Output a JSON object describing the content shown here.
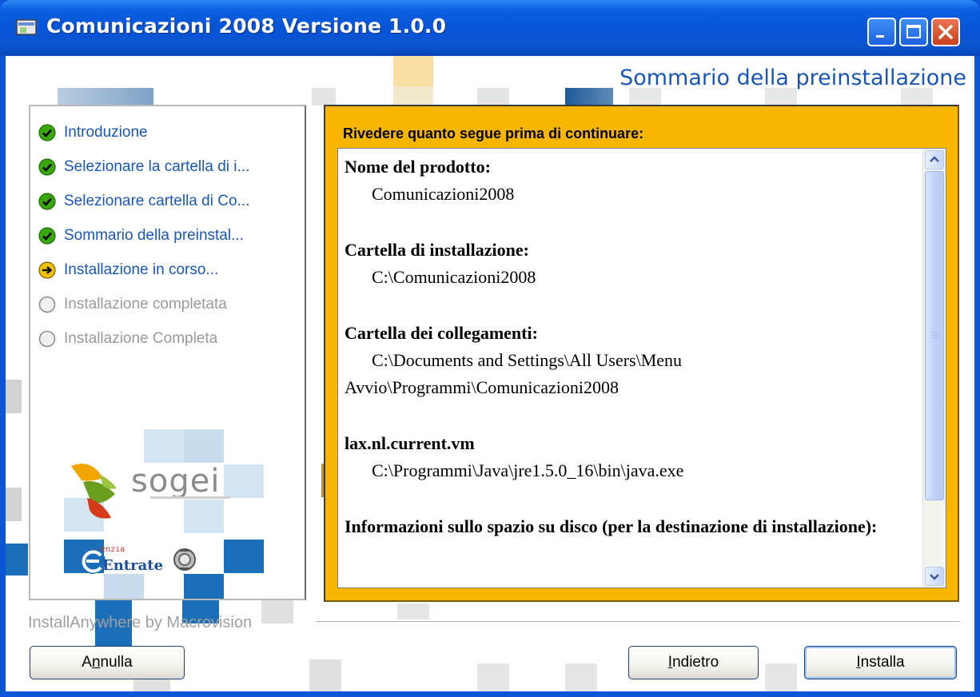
{
  "window": {
    "title": "Comunicazioni 2008 Versione 1.0.0",
    "header": "Sommario della preinstallazione"
  },
  "steps": [
    {
      "label": "Introduzione",
      "status": "done"
    },
    {
      "label": "Selezionare la cartella di i...",
      "status": "done"
    },
    {
      "label": "Selezionare cartella di Co...",
      "status": "done"
    },
    {
      "label": "Sommario della preinstal...",
      "status": "done"
    },
    {
      "label": "Installazione in corso...",
      "status": "current"
    },
    {
      "label": "Installazione completata",
      "status": "pending"
    },
    {
      "label": "Installazione Completa",
      "status": "pending"
    }
  ],
  "summary": {
    "heading": "Rivedere quanto segue prima di continuare:",
    "product_label": "Nome del prodotto:",
    "product_value": "Comunicazioni2008",
    "install_folder_label": "Cartella di installazione:",
    "install_folder_value": "C:\\Comunicazioni2008",
    "links_folder_label": "Cartella dei collegamenti:",
    "links_folder_value": "C:\\Documents and Settings\\All Users\\Menu Avvio\\Programmi\\Comunicazioni2008",
    "vm_label": "lax.nl.current.vm",
    "vm_value": "C:\\Programmi\\Java\\jre1.5.0_16\\bin\\java.exe",
    "disk_label": "Informazioni sullo spazio su disco (per la destinazione di installazione):"
  },
  "logos": {
    "sogei": "sogei",
    "entrate": "Entrate"
  },
  "footer": {
    "installanywhere": "InstallAnywhere by Macrovision"
  },
  "buttons": {
    "cancel_pre": "A",
    "cancel_mnemonic": "n",
    "cancel_post": "nulla",
    "back_pre": "",
    "back_mnemonic": "I",
    "back_post": "ndietro",
    "install_pre": "",
    "install_mnemonic": "I",
    "install_post": "nstalla"
  },
  "colors": {
    "accent_blue": "#1a56b8",
    "orange_frame": "#f6b600",
    "done_green": "#3aa80c",
    "current_yellow": "#f2c200"
  },
  "icons": {
    "done": "check-circle-icon",
    "current": "arrow-right-circle-icon",
    "pending": "empty-circle-icon"
  }
}
